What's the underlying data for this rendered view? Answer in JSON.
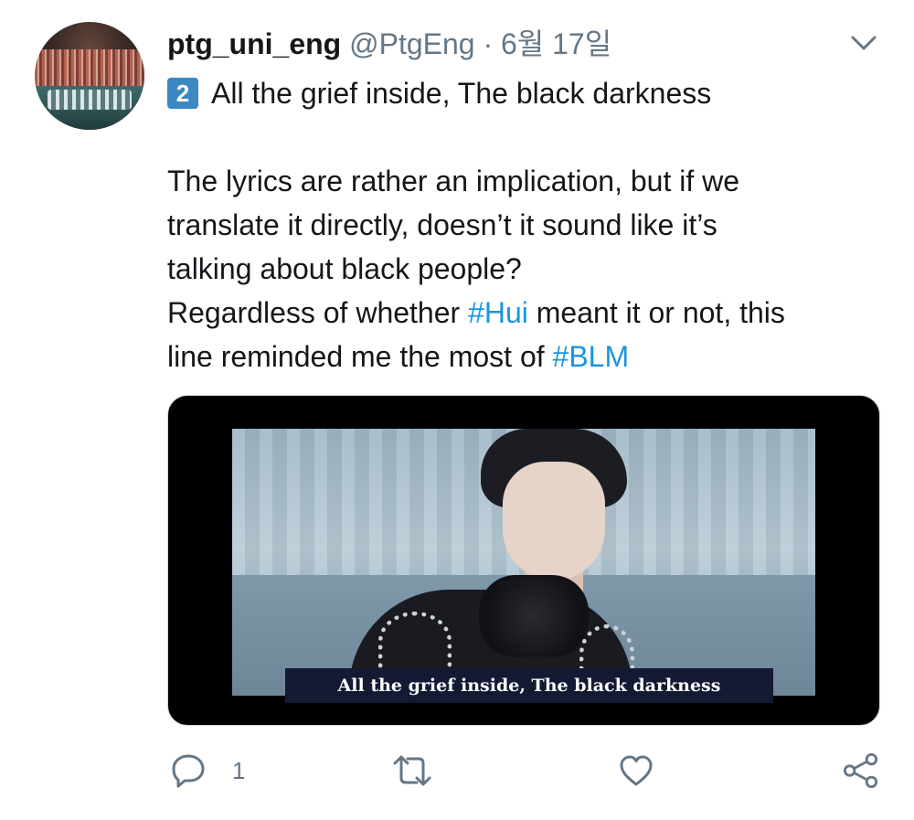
{
  "tweet": {
    "author": {
      "display_name": "ptg_uni_eng",
      "handle": "@PtgEng",
      "avatar_icon": "concert-crowd-avatar"
    },
    "separator": "·",
    "date": "6월 17일",
    "menu_icon": "chevron-down-icon",
    "body": {
      "keycap_emoji": "2",
      "line1": "All the grief inside, The black darkness",
      "para2": {
        "line1": "The lyrics are rather an implication, but if we",
        "line2": "translate it directly, doesn’t it sound like it’s",
        "line3": "talking about black people?",
        "line4_pre": "Regardless of whether ",
        "line4_hashtag": "#Hui",
        "line4_post": " meant it or not, this",
        "line5_pre": "line reminded me the most of ",
        "line5_hashtag": "#BLM"
      }
    },
    "media": {
      "subtitle": "All the grief inside, The black darkness"
    },
    "actions": {
      "reply_count": "1",
      "reply_icon": "reply-bubble-icon",
      "retweet_icon": "retweet-icon",
      "like_icon": "heart-icon",
      "share_icon": "share-icon"
    },
    "colors": {
      "hashtag": "#1b95e0",
      "secondary_text": "#657786",
      "primary_text": "#14171a",
      "keycap": "#3b88c3"
    }
  }
}
